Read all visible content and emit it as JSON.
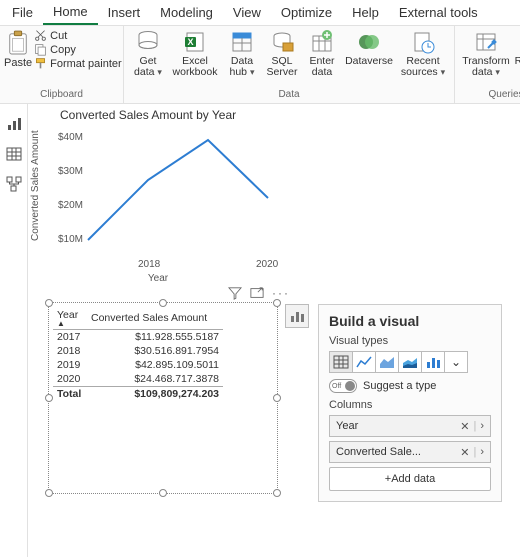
{
  "menubar": {
    "tabs": [
      "File",
      "Home",
      "Insert",
      "Modeling",
      "View",
      "Optimize",
      "Help",
      "External tools"
    ],
    "active": 1
  },
  "ribbon": {
    "clipboard": {
      "paste": "Paste",
      "cut": "Cut",
      "copy": "Copy",
      "format_painter": "Format painter",
      "group": "Clipboard"
    },
    "data": {
      "group": "Data",
      "get_data": "Get data",
      "excel": "Excel workbook",
      "datahub": "Data hub",
      "sql": "SQL Server",
      "enter": "Enter data",
      "dataverse": "Dataverse",
      "recent": "Recent sources"
    },
    "queries": {
      "group": "Queries",
      "transform": "Transform data",
      "refresh": "Refresh"
    }
  },
  "chart_data": {
    "type": "line",
    "title": "Converted Sales Amount by Year",
    "xlabel": "Year",
    "ylabel": "Converted Sales Amount",
    "x": [
      2017,
      2018,
      2019,
      2020
    ],
    "y": [
      11928555.5187,
      30516891.7954,
      42895109.5011,
      24468717.3878
    ],
    "yticks": [
      "$10M",
      "$20M",
      "$30M",
      "$40M"
    ],
    "xticks": [
      "2018",
      "2020"
    ]
  },
  "table": {
    "columns": [
      "Year",
      "Converted Sales Amount"
    ],
    "rows": [
      {
        "year": "2017",
        "val": "$11.928.555.5187"
      },
      {
        "year": "2018",
        "val": "$30.516.891.7954"
      },
      {
        "year": "2019",
        "val": "$42.895.109.5011"
      },
      {
        "year": "2020",
        "val": "$24.468.717.3878"
      }
    ],
    "total_label": "Total",
    "total_val": "$109,809,274.203"
  },
  "pane": {
    "title": "Build a visual",
    "visual_types_label": "Visual types",
    "suggest_label": "Suggest a type",
    "toggle_label": "Off",
    "columns_label": "Columns",
    "fields": [
      {
        "label": "Year"
      },
      {
        "label": "Converted Sale..."
      }
    ],
    "add": "+Add data"
  }
}
